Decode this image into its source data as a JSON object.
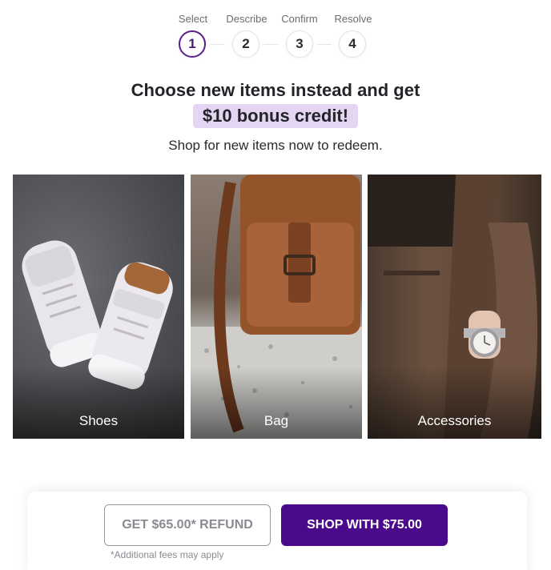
{
  "stepper": {
    "steps": [
      {
        "label": "Select",
        "number": "1",
        "active": true
      },
      {
        "label": "Describe",
        "number": "2",
        "active": false
      },
      {
        "label": "Confirm",
        "number": "3",
        "active": false
      },
      {
        "label": "Resolve",
        "number": "4",
        "active": false
      }
    ]
  },
  "hero": {
    "headline": "Choose new items instead and get",
    "bonus": "$10 bonus credit!",
    "subline": "Shop for new items now to redeem."
  },
  "categories": [
    {
      "label": "Shoes"
    },
    {
      "label": "Bag"
    },
    {
      "label": "Accessories"
    }
  ],
  "actions": {
    "refund_label": "GET  $65.00* REFUND",
    "shop_label": "SHOP WITH $75.00",
    "fees_note": "*Additional fees may apply"
  },
  "colors": {
    "accent": "#4b0a8c",
    "bonus_highlight": "#e4d6f2",
    "active_step_border": "#5a1f8c"
  }
}
